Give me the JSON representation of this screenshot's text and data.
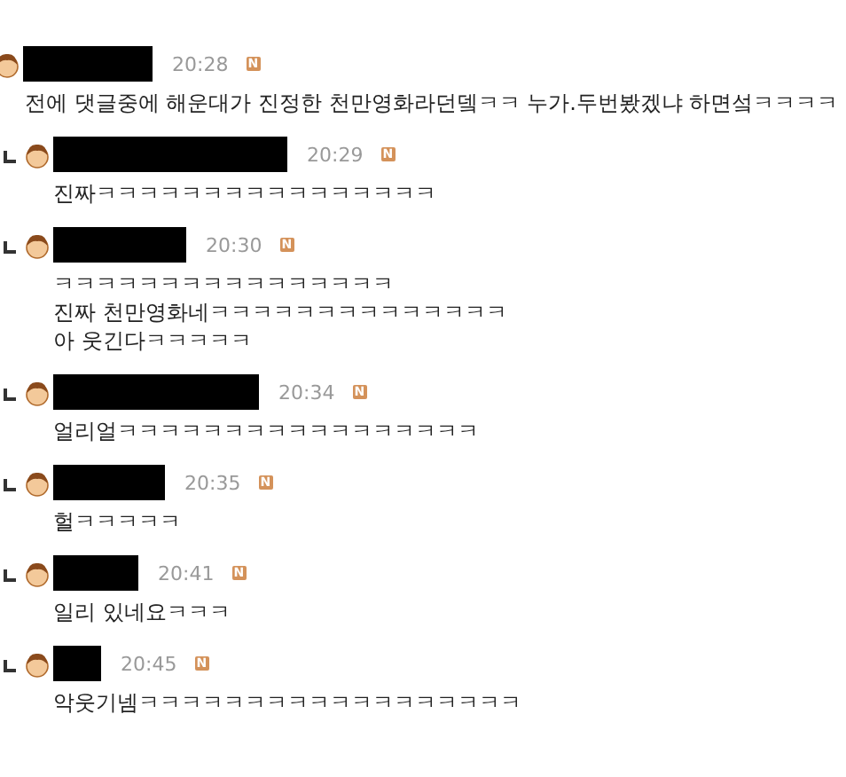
{
  "comments": [
    {
      "kind": "comment",
      "time": "20:28",
      "badge": "N",
      "lines": [
        "전에 댓글중에 해운대가 진정한 천만영화라던뎈ㅋㅋ 누가.두번봤겠냐 하면섴ㅋㅋㅋㅋ"
      ]
    },
    {
      "kind": "reply",
      "time": "20:29",
      "badge": "N",
      "lines": [
        "진짜ㅋㅋㅋㅋㅋㅋㅋㅋㅋㅋㅋㅋㅋㅋㅋㅋ"
      ]
    },
    {
      "kind": "reply",
      "time": "20:30",
      "badge": "N",
      "lines": [
        "ㅋㅋㅋㅋㅋㅋㅋㅋㅋㅋㅋㅋㅋㅋㅋㅋ",
        "진짜 천만영화네ㅋㅋㅋㅋㅋㅋㅋㅋㅋㅋㅋㅋㅋㅋ",
        "아 웃긴다ㅋㅋㅋㅋㅋ"
      ]
    },
    {
      "kind": "reply",
      "time": "20:34",
      "badge": "N",
      "lines": [
        "얼리얼ㅋㅋㅋㅋㅋㅋㅋㅋㅋㅋㅋㅋㅋㅋㅋㅋㅋ"
      ]
    },
    {
      "kind": "reply",
      "time": "20:35",
      "badge": "N",
      "lines": [
        "헐ㅋㅋㅋㅋㅋ"
      ]
    },
    {
      "kind": "reply",
      "time": "20:41",
      "badge": "N",
      "lines": [
        "일리 있네요ㅋㅋㅋ"
      ]
    },
    {
      "kind": "reply",
      "time": "20:45",
      "badge": "N",
      "lines": [
        "악웃기넴ㅋㅋㅋㅋㅋㅋㅋㅋㅋㅋㅋㅋㅋㅋㅋㅋㅋㅋ"
      ]
    }
  ]
}
